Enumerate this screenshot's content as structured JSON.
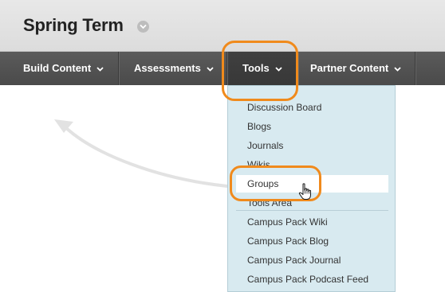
{
  "header": {
    "title": "Spring Term"
  },
  "nav": {
    "items": [
      {
        "label": "Build Content"
      },
      {
        "label": "Assessments"
      },
      {
        "label": "Tools"
      },
      {
        "label": "Partner Content"
      }
    ]
  },
  "tools_menu": {
    "items": [
      {
        "label": "Discussion Board"
      },
      {
        "label": "Blogs"
      },
      {
        "label": "Journals"
      },
      {
        "label": "Wikis"
      },
      {
        "label": "Groups"
      },
      {
        "label": "Tools Area"
      },
      {
        "label": "Campus Pack Wiki"
      },
      {
        "label": "Campus Pack Blog"
      },
      {
        "label": "Campus Pack Journal"
      },
      {
        "label": "Campus Pack Podcast Feed"
      }
    ],
    "selected": "Groups"
  },
  "colors": {
    "nav_background": "#4f4f4f",
    "menu_background": "#d8eaf0",
    "highlight": "#f08a1c"
  },
  "icons": [
    "chevron-down-icon",
    "hand-pointer-icon",
    "curved-arrow-icon"
  ]
}
